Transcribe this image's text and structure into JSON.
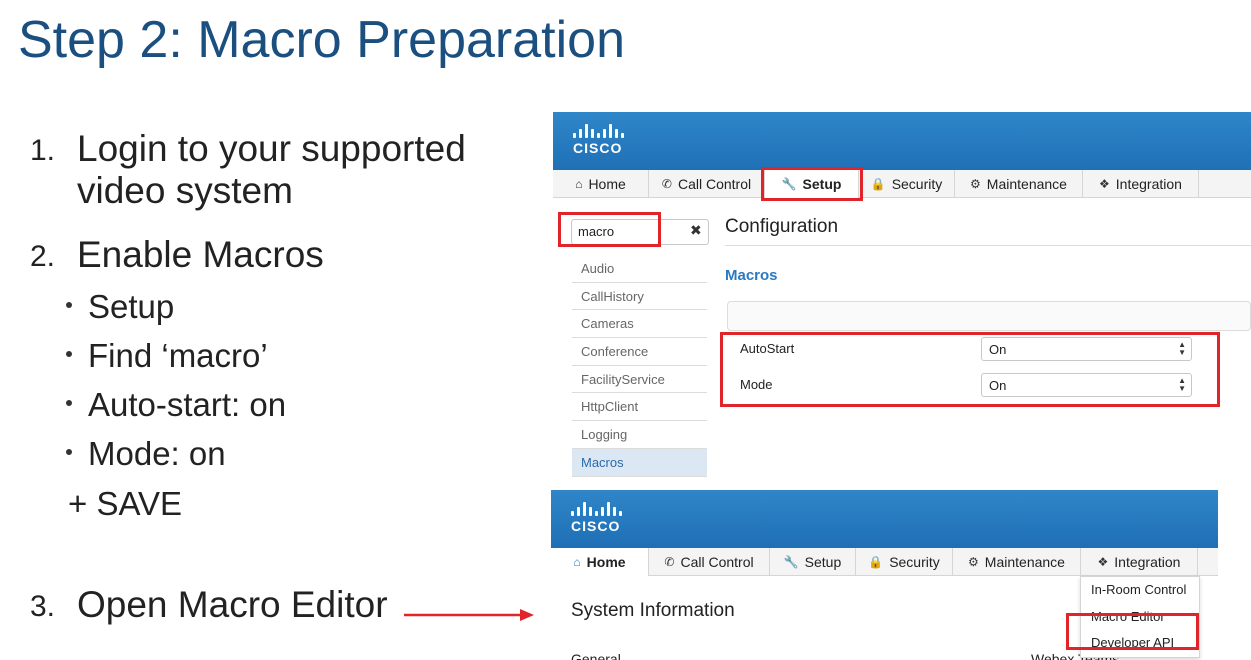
{
  "slide": {
    "title": "Step 2: Macro Preparation"
  },
  "steps": [
    {
      "num": "1.",
      "bold": "Login",
      "rest": " to your supported",
      "line2": "video system"
    },
    {
      "num": "2.",
      "bold": "Enable Macros"
    },
    {
      "num": "3.",
      "bold": "Open Macro Editor"
    }
  ],
  "bullets": [
    "Setup",
    "Find ‘macro’",
    "Auto-start: on",
    "Mode: on"
  ],
  "save": "+ SAVE",
  "top_panel": {
    "logo": "CISCO",
    "tabs": [
      {
        "icon": "⌂",
        "label": "Home"
      },
      {
        "icon": "✆",
        "label": "Call Control"
      },
      {
        "icon": "🔧",
        "label": "Setup"
      },
      {
        "icon": "🔒",
        "label": "Security"
      },
      {
        "icon": "⚙",
        "label": "Maintenance"
      },
      {
        "icon": "❖",
        "label": "Integration"
      }
    ],
    "search_value": "macro",
    "sidebar": [
      "Audio",
      "CallHistory",
      "Cameras",
      "Conference",
      "FacilityService",
      "HttpClient",
      "Logging",
      "Macros"
    ],
    "config_title": "Configuration",
    "section": "Macros",
    "rows": [
      {
        "label": "AutoStart",
        "value": "On"
      },
      {
        "label": "Mode",
        "value": "On"
      }
    ]
  },
  "bottom_panel": {
    "logo": "CISCO",
    "tabs": [
      {
        "icon": "⌂",
        "label": "Home"
      },
      {
        "icon": "✆",
        "label": "Call Control"
      },
      {
        "icon": "🔧",
        "label": "Setup"
      },
      {
        "icon": "🔒",
        "label": "Security"
      },
      {
        "icon": "⚙",
        "label": "Maintenance"
      },
      {
        "icon": "❖",
        "label": "Integration"
      }
    ],
    "title": "System Information",
    "general": "General",
    "webex": "Webex Teams",
    "dropdown": [
      "In-Room Control",
      "Macro Editor",
      "Developer API"
    ]
  },
  "colors": {
    "accent": "#1f6fb5",
    "highlight": "#e0242a",
    "title": "#1a4f80"
  }
}
